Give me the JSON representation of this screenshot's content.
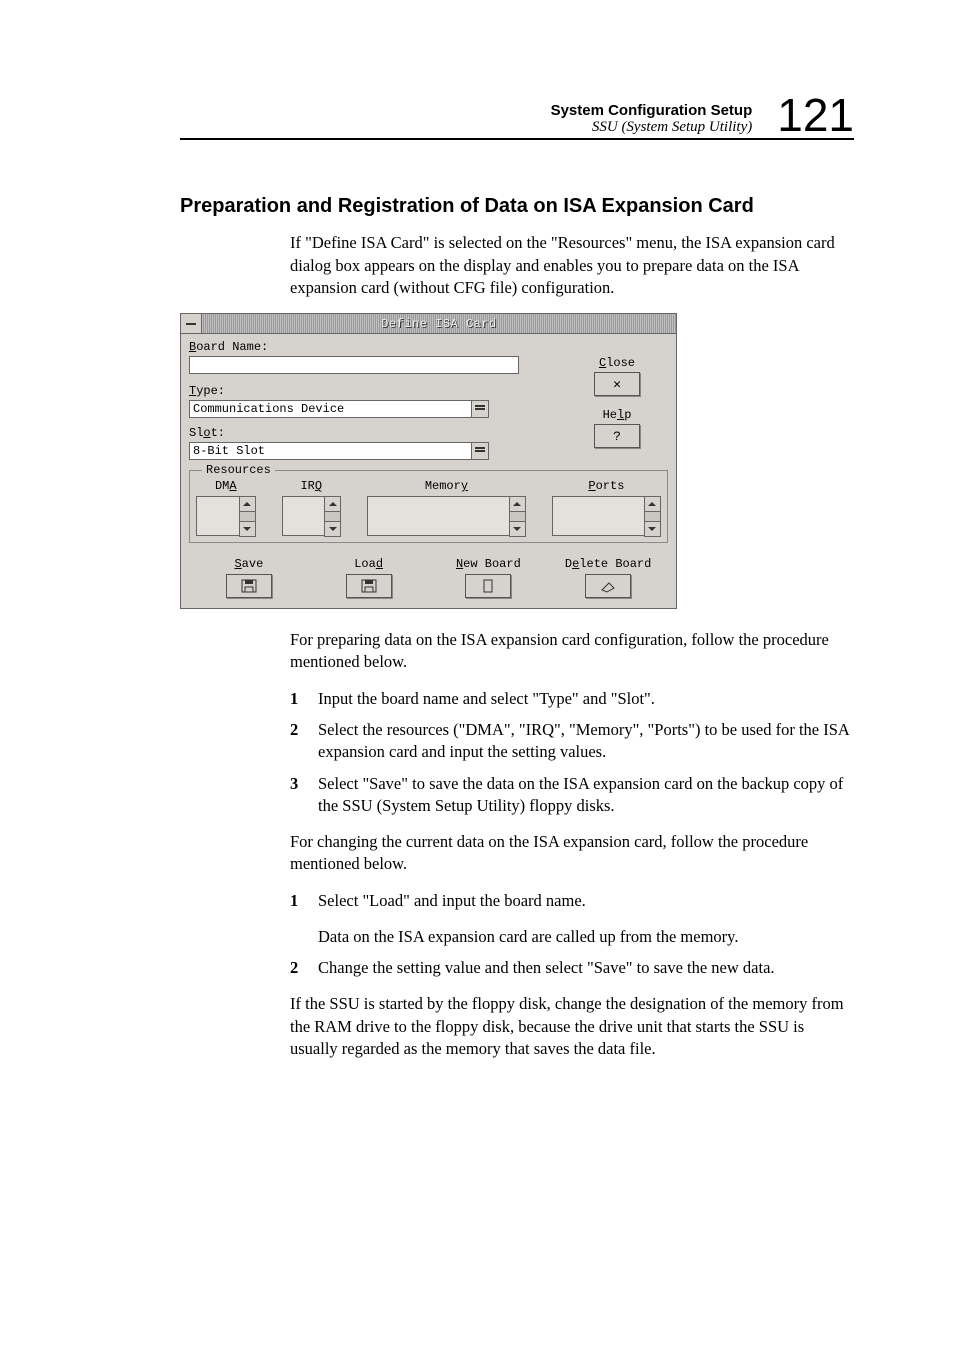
{
  "header": {
    "section": "System Configuration Setup",
    "subsection": "SSU (System Setup Utility)",
    "page_number": "121"
  },
  "heading": "Preparation and Registration of Data on ISA Expansion Card",
  "intro": "If \"Define ISA Card\" is selected on the \"Resources\" menu, the ISA expansion card dialog box appears on the display and enables you to prepare data on the ISA expansion card (without CFG file) configuration.",
  "dialog": {
    "title": "Define ISA Card",
    "board_name_label": "Board Name:",
    "board_name_value": "",
    "type_label": "Type:",
    "type_value": "Communications Device",
    "slot_label": "Slot:",
    "slot_value": "8-Bit Slot",
    "close_label": "Close",
    "close_glyph": "✕",
    "help_label": "Help",
    "help_glyph": "?",
    "resources_legend": "Resources",
    "res_cols": {
      "dma": "DMA",
      "irq": "IRQ",
      "memory": "Memory",
      "ports": "Ports"
    },
    "actions": {
      "save": "Save",
      "load": "Load",
      "new_board": "New Board",
      "delete_board": "Delete Board"
    }
  },
  "prep_intro": "For preparing data on the ISA expansion card configuration, follow the procedure mentioned below.",
  "prep_steps": [
    "Input the board name and select \"Type\" and \"Slot\".",
    "Select the resources (\"DMA\", \"IRQ\", \"Memory\", \"Ports\") to be used for the ISA expansion card and input the setting values.",
    "Select \"Save\" to save the data on the ISA expansion card on the backup copy of the SSU (System Setup Utility) floppy disks."
  ],
  "change_intro": "For changing the current data on the ISA expansion card, follow the procedure mentioned below.",
  "change_steps": [
    "Select \"Load\" and input the board name.",
    "Change the setting value and then select \"Save\" to save the new data."
  ],
  "change_step1_sub": "Data on the ISA expansion card are called up from the memory.",
  "footer_para": "If the SSU is started by the floppy disk, change the designation of the memory from the RAM drive to the floppy disk, because the drive unit that starts the SSU is usually regarded as the memory that saves the data file."
}
